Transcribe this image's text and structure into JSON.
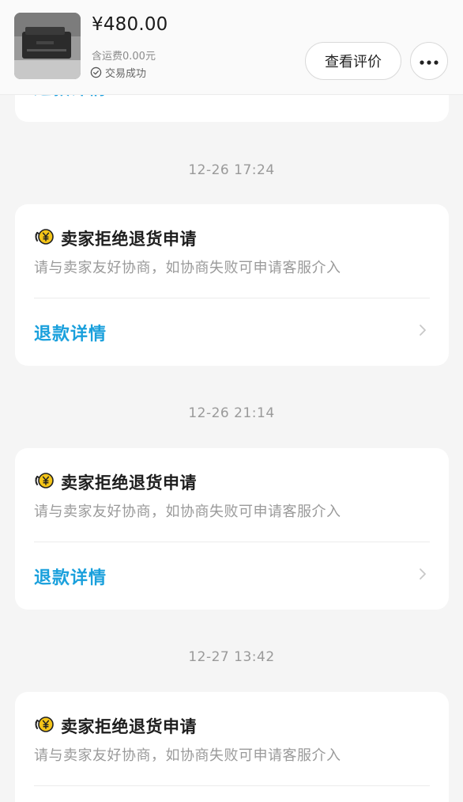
{
  "header": {
    "price": "¥480.00",
    "shipping": "含运费0.00元",
    "status": "交易成功",
    "review_button": "查看评价"
  },
  "previous_card": {
    "link_label": "退款详情"
  },
  "events": [
    {
      "timestamp": "12-26 17:24",
      "title": "卖家拒绝退货申请",
      "description": "请与卖家友好协商，如协商失败可申请客服介入",
      "link_label": "退款详情"
    },
    {
      "timestamp": "12-26 21:14",
      "title": "卖家拒绝退货申请",
      "description": "请与卖家友好协商，如协商失败可申请客服介入",
      "link_label": "退款详情"
    },
    {
      "timestamp": "12-27 13:42",
      "title": "卖家拒绝退货申请",
      "description": "请与卖家友好协商，如协商失败可申请客服介入"
    }
  ],
  "colors": {
    "link": "#1aa0dc",
    "icon_yellow": "#f5c518",
    "background": "#f5f5f5"
  },
  "icons": {
    "status": "check-circle-icon",
    "more": "more-dots-icon",
    "event": "refund-coin-icon",
    "chevron": "chevron-right-icon"
  }
}
